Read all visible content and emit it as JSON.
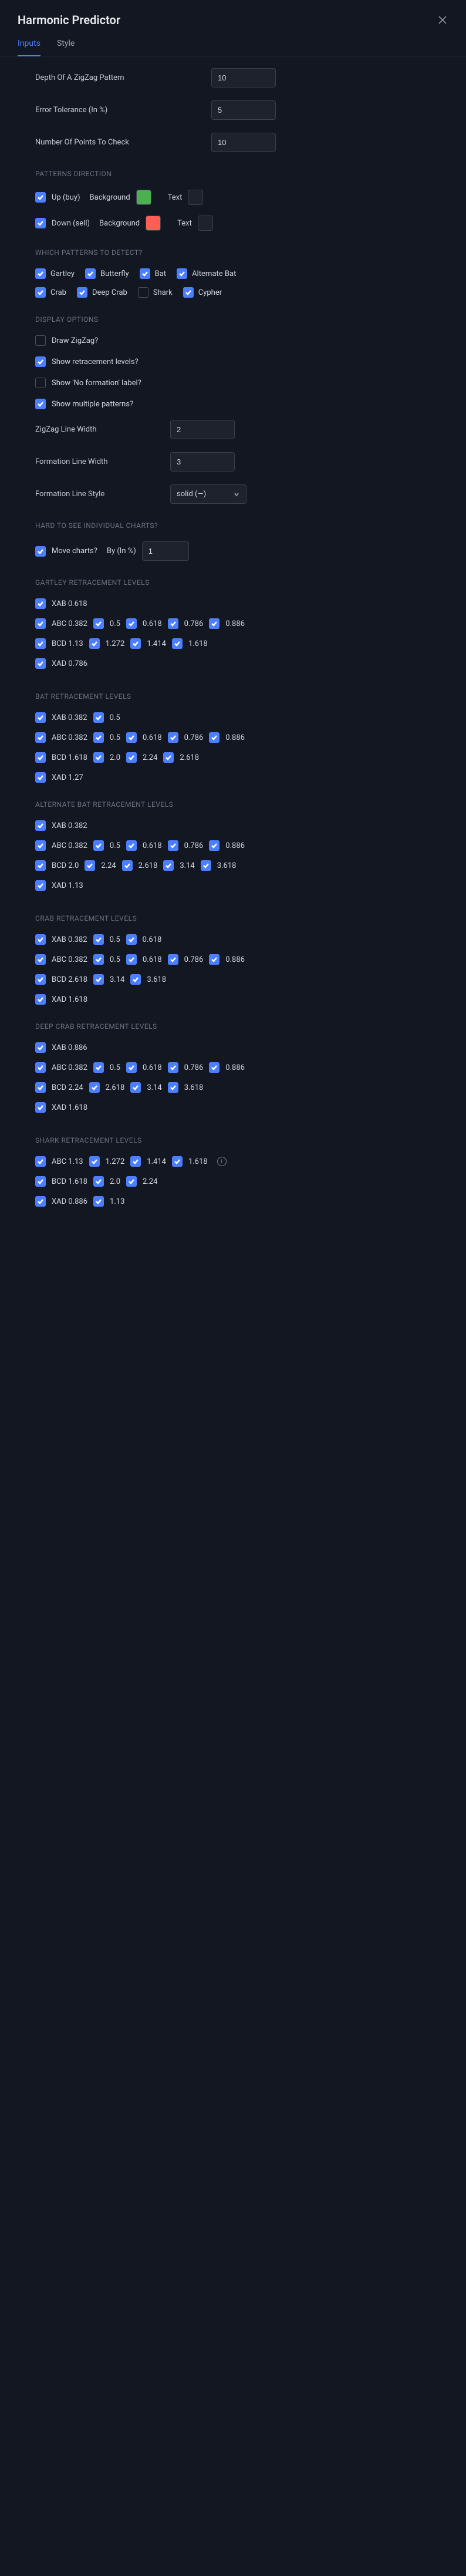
{
  "header": {
    "title": "Harmonic Predictor"
  },
  "tabs": {
    "inputs": "Inputs",
    "style": "Style"
  },
  "basic": {
    "depth_label": "Depth Of A ZigZag Pattern",
    "depth_value": "10",
    "err_label": "Error Tolerance (In %)",
    "err_value": "5",
    "points_label": "Number Of Points To Check",
    "points_value": "10"
  },
  "direction": {
    "head": "PATTERNS DIRECTION",
    "up_label": "Up (buy)",
    "down_label": "Down (sell)",
    "bg_label": "Background",
    "text_label": "Text"
  },
  "patterns": {
    "head": "WHICH PATTERNS TO DETECT?",
    "gartley": "Gartley",
    "butterfly": "Butterfly",
    "bat": "Bat",
    "altbat": "Alternate Bat",
    "crab": "Crab",
    "deepcrab": "Deep Crab",
    "shark": "Shark",
    "cypher": "Cypher"
  },
  "display": {
    "head": "DISPLAY OPTIONS",
    "draw_zigzag": "Draw ZigZag?",
    "show_retr": "Show retracement levels?",
    "show_no_form": "Show 'No formation' label?",
    "show_multi": "Show multiple patterns?",
    "zz_width_label": "ZigZag Line Width",
    "zz_width_value": "2",
    "form_width_label": "Formation Line Width",
    "form_width_value": "3",
    "form_style_label": "Formation Line Style",
    "form_style_value": "solid (—)"
  },
  "move": {
    "head": "HARD TO SEE INDIVIDUAL CHARTS?",
    "move_label": "Move charts?",
    "by_label": "By (In %)",
    "by_value": "1"
  },
  "gartley_r": {
    "head": "GARTLEY RETRACEMENT LEVELS",
    "xab": "XAB 0.618",
    "abc1": "ABC 0.382",
    "abc2": "0.5",
    "abc3": "0.618",
    "abc4": "0.786",
    "abc5": "0.886",
    "bcd1": "BCD 1.13",
    "bcd2": "1.272",
    "bcd3": "1.414",
    "bcd4": "1.618",
    "xad": "XAD 0.786"
  },
  "bat_r": {
    "head": "BAT RETRACEMENT LEVELS",
    "xab1": "XAB 0.382",
    "xab2": "0.5",
    "abc1": "ABC 0.382",
    "abc2": "0.5",
    "abc3": "0.618",
    "abc4": "0.786",
    "abc5": "0.886",
    "bcd1": "BCD 1.618",
    "bcd2": "2.0",
    "bcd3": "2.24",
    "bcd4": "2.618",
    "xad": "XAD 1.27"
  },
  "altbat_r": {
    "head": "ALTERNATE BAT RETRACEMENT LEVELS",
    "xab": "XAB 0.382",
    "abc1": "ABC 0.382",
    "abc2": "0.5",
    "abc3": "0.618",
    "abc4": "0.786",
    "abc5": "0.886",
    "bcd1": "BCD 2.0",
    "bcd2": "2.24",
    "bcd3": "2.618",
    "bcd4": "3.14",
    "bcd5": "3.618",
    "xad": "XAD 1.13"
  },
  "crab_r": {
    "head": "CRAB RETRACEMENT LEVELS",
    "xab1": "XAB 0.382",
    "xab2": "0.5",
    "xab3": "0.618",
    "abc1": "ABC 0.382",
    "abc2": "0.5",
    "abc3": "0.618",
    "abc4": "0.786",
    "abc5": "0.886",
    "bcd1": "BCD 2.618",
    "bcd2": "3.14",
    "bcd3": "3.618",
    "xad": "XAD 1.618"
  },
  "deepcrab_r": {
    "head": "DEEP CRAB RETRACEMENT LEVELS",
    "xab": "XAB 0.886",
    "abc1": "ABC 0.382",
    "abc2": "0.5",
    "abc3": "0.618",
    "abc4": "0.786",
    "abc5": "0.886",
    "bcd1": "BCD 2.24",
    "bcd2": "2.618",
    "bcd3": "3.14",
    "bcd4": "3.618",
    "xad": "XAD 1.618"
  },
  "shark_r": {
    "head": "SHARK RETRACEMENT LEVELS",
    "abc1": "ABC 1.13",
    "abc2": "1.272",
    "abc3": "1.414",
    "abc4": "1.618",
    "bcd1": "BCD 1.618",
    "bcd2": "2.0",
    "bcd3": "2.24",
    "xad1": "XAD 0.886",
    "xad2": "1.13"
  },
  "info_glyph": "i"
}
